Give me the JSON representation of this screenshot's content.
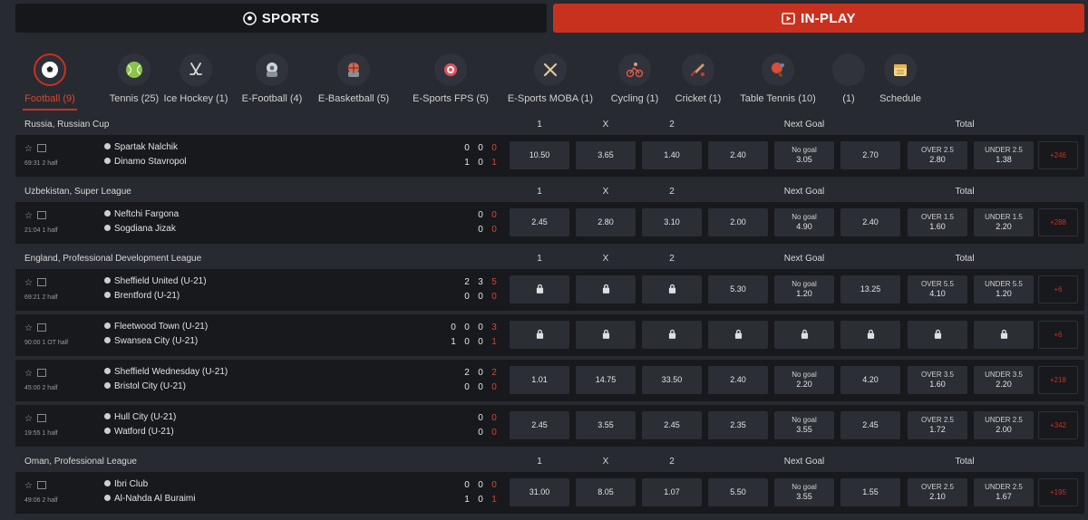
{
  "top": {
    "sports_label": "SPORTS",
    "inplay_label": "IN-PLAY",
    "sports_icon": "soccer-ball-icon",
    "inplay_icon": "play-screen-icon",
    "accent": "#c9311f"
  },
  "tabs": [
    {
      "label": "Football (9)",
      "icon": "soccer-ball-icon",
      "active": true
    },
    {
      "label": "Tennis (25)",
      "icon": "tennis-ball-icon"
    },
    {
      "label": "Ice Hockey (1)",
      "icon": "hockey-sticks-icon"
    },
    {
      "label": "E-Football (4)",
      "icon": "gamer-football-icon"
    },
    {
      "label": "E-Basketball (5)",
      "icon": "gamer-basketball-icon"
    },
    {
      "label": "E-Sports FPS (5)",
      "icon": "crosshair-icon"
    },
    {
      "label": "E-Sports MOBA (1)",
      "icon": "crossed-swords-icon"
    },
    {
      "label": "Cycling (1)",
      "icon": "cyclist-icon"
    },
    {
      "label": "Cricket (1)",
      "icon": "cricket-bat-icon"
    },
    {
      "label": "Table Tennis (10)",
      "icon": "table-tennis-icon"
    },
    {
      "label": "(1)",
      "icon": "blank-icon"
    },
    {
      "label": "Schedule",
      "icon": "calendar-icon"
    }
  ],
  "columns": {
    "c1": "1",
    "cx": "X",
    "c2": "2",
    "next_goal": "Next Goal",
    "total": "Total"
  },
  "leagues": [
    {
      "name": "Russia, Russian Cup",
      "matches": [
        {
          "time": "69:31  2 half",
          "team1": "Spartak Nalchik",
          "team2": "Dinamo Stavropol",
          "score1": [
            "0",
            "0",
            "0"
          ],
          "score2": [
            "1",
            "0",
            "1"
          ],
          "odds": [
            {
              "val": "10.50"
            },
            {
              "val": "3.65"
            },
            {
              "val": "1.40"
            },
            {
              "val": "2.40"
            },
            {
              "sub": "No goal",
              "val": "3.05"
            },
            {
              "val": "2.70"
            },
            {
              "sub": "OVER 2.5",
              "val": "2.80"
            },
            {
              "sub": "UNDER 2.5",
              "val": "1.38"
            }
          ],
          "more": "+246"
        }
      ]
    },
    {
      "name": "Uzbekistan, Super League",
      "matches": [
        {
          "time": "21:04  1 half",
          "team1": "Neftchi Fargona",
          "team2": "Sogdiana Jizak",
          "score1": [
            "0",
            "0"
          ],
          "score2": [
            "0",
            "0"
          ],
          "odds": [
            {
              "val": "2.45"
            },
            {
              "val": "2.80"
            },
            {
              "val": "3.10"
            },
            {
              "val": "2.00"
            },
            {
              "sub": "No goal",
              "val": "4.90"
            },
            {
              "val": "2.40"
            },
            {
              "sub": "OVER 1.5",
              "val": "1.60"
            },
            {
              "sub": "UNDER 1.5",
              "val": "2.20"
            }
          ],
          "more": "+288"
        }
      ]
    },
    {
      "name": "England, Professional Development League",
      "matches": [
        {
          "time": "69:21  2 half",
          "team1": "Sheffield United (U-21)",
          "team2": "Brentford (U-21)",
          "score1": [
            "2",
            "3",
            "5"
          ],
          "score2": [
            "0",
            "0",
            "0"
          ],
          "odds": [
            {
              "lock": true
            },
            {
              "lock": true
            },
            {
              "lock": true
            },
            {
              "val": "5.30"
            },
            {
              "sub": "No goal",
              "val": "1.20"
            },
            {
              "val": "13.25"
            },
            {
              "sub": "OVER 5.5",
              "val": "4.10"
            },
            {
              "sub": "UNDER 5.5",
              "val": "1.20"
            }
          ],
          "more": "+6"
        },
        {
          "time": "90:00  1 OT half",
          "team1": "Fleetwood Town (U-21)",
          "team2": "Swansea City (U-21)",
          "score1": [
            "0",
            "0",
            "0",
            "3"
          ],
          "score2": [
            "1",
            "0",
            "0",
            "1"
          ],
          "odds": [
            {
              "lock": true
            },
            {
              "lock": true
            },
            {
              "lock": true
            },
            {
              "lock": true
            },
            {
              "lock": true
            },
            {
              "lock": true
            },
            {
              "lock": true
            },
            {
              "lock": true
            }
          ],
          "more": "+6"
        },
        {
          "time": "45:00  2 half",
          "team1": "Sheffield Wednesday (U-21)",
          "team2": "Bristol City (U-21)",
          "score1": [
            "2",
            "0",
            "2"
          ],
          "score2": [
            "0",
            "0",
            "0"
          ],
          "odds": [
            {
              "val": "1.01"
            },
            {
              "val": "14.75"
            },
            {
              "val": "33.50"
            },
            {
              "val": "2.40"
            },
            {
              "sub": "No goal",
              "val": "2.20"
            },
            {
              "val": "4.20"
            },
            {
              "sub": "OVER 3.5",
              "val": "1.60"
            },
            {
              "sub": "UNDER 3.5",
              "val": "2.20"
            }
          ],
          "more": "+218"
        },
        {
          "time": "19:55  1 half",
          "team1": "Hull City (U-21)",
          "team2": "Watford (U-21)",
          "score1": [
            "0",
            "0"
          ],
          "score2": [
            "0",
            "0"
          ],
          "odds": [
            {
              "val": "2.45"
            },
            {
              "val": "3.55"
            },
            {
              "val": "2.45"
            },
            {
              "val": "2.35"
            },
            {
              "sub": "No goal",
              "val": "3.55"
            },
            {
              "val": "2.45"
            },
            {
              "sub": "OVER 2.5",
              "val": "1.72"
            },
            {
              "sub": "UNDER 2.5",
              "val": "2.00"
            }
          ],
          "more": "+342"
        }
      ]
    },
    {
      "name": "Oman, Professional League",
      "matches": [
        {
          "time": "49:06  2 half",
          "team1": "Ibri Club",
          "team2": "Al-Nahda Al Buraimi",
          "score1": [
            "0",
            "0",
            "0"
          ],
          "score2": [
            "1",
            "0",
            "1"
          ],
          "odds": [
            {
              "val": "31.00"
            },
            {
              "val": "8.05"
            },
            {
              "val": "1.07"
            },
            {
              "val": "5.50"
            },
            {
              "sub": "No goal",
              "val": "3.55"
            },
            {
              "val": "1.55"
            },
            {
              "sub": "OVER 2.5",
              "val": "2.10"
            },
            {
              "sub": "UNDER 2.5",
              "val": "1.67"
            }
          ],
          "more": "+195"
        }
      ]
    }
  ]
}
